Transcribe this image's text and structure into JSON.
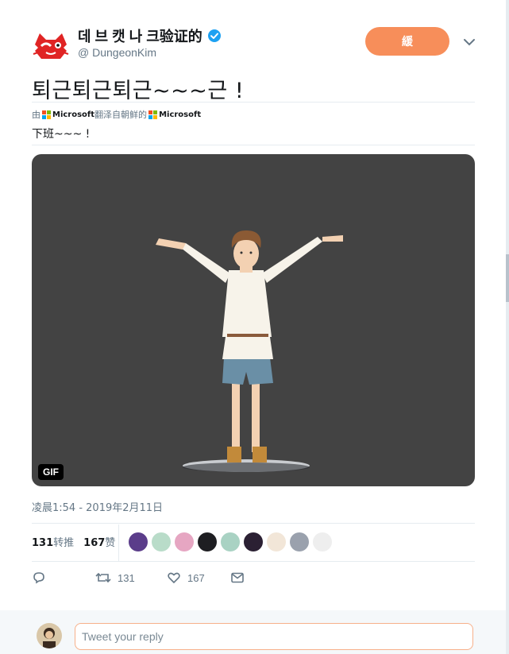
{
  "author": {
    "display_name": "데 브 캣 나 크验证的",
    "handle": "@ DungeonKim",
    "verified": true
  },
  "follow_button_label": "緩",
  "tweet": {
    "text": "퇴근퇴근퇴근~~~근 !",
    "translation_prefix": "由",
    "translation_ms1": "Microsoft",
    "translation_mid": "翻泽自朝鲜的",
    "translation_ms2": "Microsoft",
    "translated_text": "下班~~~ !"
  },
  "media": {
    "badge": "GIF"
  },
  "timestamp": "凌晨1:54 - 2019年2月11日",
  "stats": {
    "retweets_count": "131",
    "retweets_label": "转推",
    "likes_count": "167",
    "likes_label": "赞"
  },
  "actions": {
    "retweet_count": "131",
    "like_count": "167"
  },
  "reply": {
    "placeholder": "Tweet your reply"
  },
  "colors": {
    "accent": "#f78e5a",
    "verified": "#1da1f2",
    "media_bg": "#434343"
  }
}
